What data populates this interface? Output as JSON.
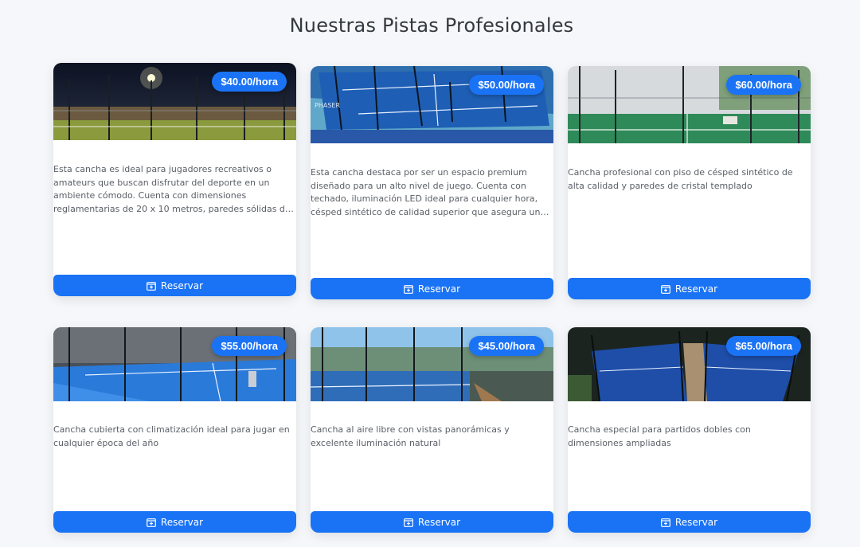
{
  "page": {
    "title": "Nuestras Pistas Profesionales"
  },
  "colors": {
    "accent": "#1a73f5",
    "background": "#f5f7fa",
    "card": "#ffffff"
  },
  "courts": [
    {
      "price": "$40.00/hora",
      "description": "Esta cancha es ideal para jugadores recreativos o amateurs que buscan disfrutar del deporte en un ambiente cómodo. Cuenta con dimensiones reglamentarias de 20 x 10 metros, paredes sólidas de cristal templado y césped sintético de buena calidad.",
      "button": "Reservar",
      "button_icon": "calendar-plus-icon"
    },
    {
      "price": "$50.00/hora",
      "description": "Esta cancha destaca por ser un espacio premium diseñado para un alto nivel de juego. Cuenta con techado, iluminación LED ideal para cualquier hora, césped sintético de calidad superior que asegura un rebote uniforme y paredes de cristal templado.",
      "button": "Reservar",
      "button_icon": "calendar-plus-icon"
    },
    {
      "price": "$60.00/hora",
      "description": "Cancha profesional con piso de césped sintético de alta calidad y paredes de cristal templado",
      "button": "Reservar",
      "button_icon": "calendar-plus-icon"
    },
    {
      "price": "$55.00/hora",
      "description": "Cancha cubierta con climatización ideal para jugar en cualquier época del año",
      "button": "Reservar",
      "button_icon": "calendar-plus-icon"
    },
    {
      "price": "$45.00/hora",
      "description": "Cancha al aire libre con vistas panorámicas y excelente iluminación natural",
      "button": "Reservar",
      "button_icon": "calendar-plus-icon"
    },
    {
      "price": "$65.00/hora",
      "description": "Cancha especial para partidos dobles con dimensiones ampliadas",
      "button": "Reservar",
      "button_icon": "calendar-plus-icon"
    }
  ]
}
